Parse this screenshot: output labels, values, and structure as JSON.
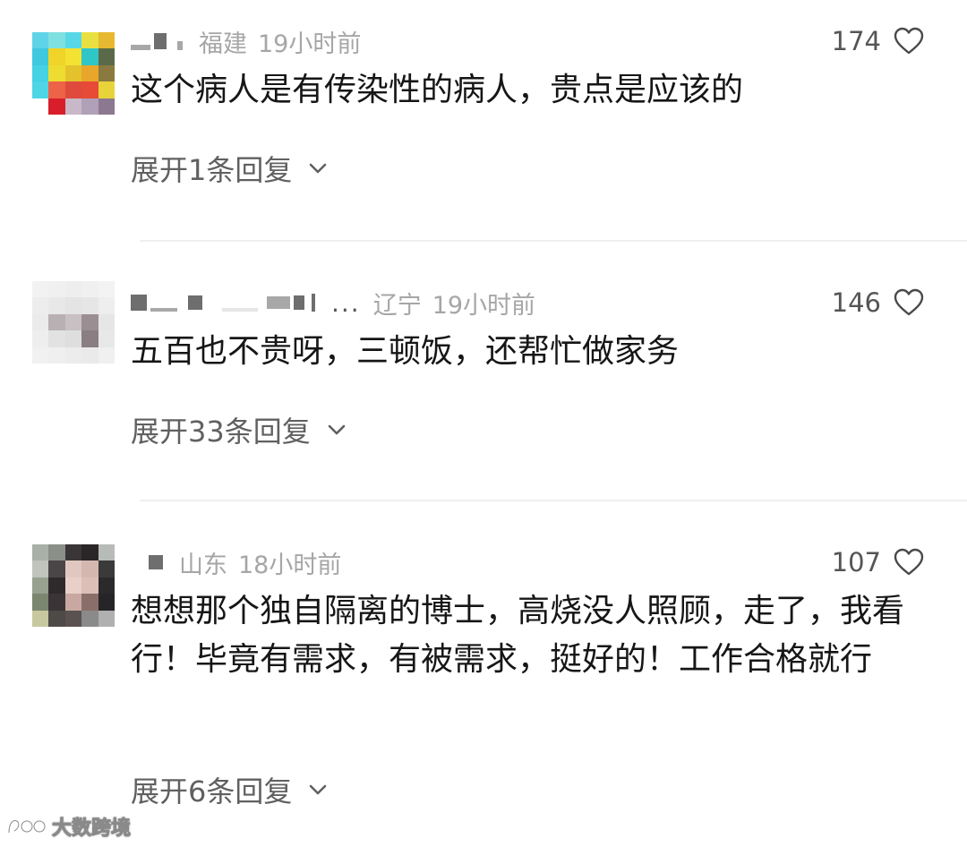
{
  "comments": [
    {
      "location": "福建",
      "time": "19小时前",
      "likes": "174",
      "text": "这个病人是有传染性的病人，贵点是应该的",
      "replies": "展开1条回复"
    },
    {
      "ellipsis": "...",
      "location": "辽宁",
      "time": "19小时前",
      "likes": "146",
      "text": "五百也不贵呀，三顿饭，还帮忙做家务",
      "replies": "展开33条回复"
    },
    {
      "location": "山东",
      "time": "18小时前",
      "likes": "107",
      "text": "想想那个独自隔离的博士，高烧没人照顾，走了，我看行！毕竟有需求，有被需求，挺好的！工作合格就行",
      "replies": "展开6条回复"
    }
  ],
  "watermark": {
    "text": "大数跨境"
  },
  "icons": {
    "like": "heart-outline-icon",
    "expand": "chevron-down-icon",
    "watermark_logo": "brand-logo-icon"
  },
  "colors": {
    "meta_gray": "#a6a6a6",
    "text": "#161616",
    "reply_gray": "#606060",
    "divider": "#efefef"
  }
}
